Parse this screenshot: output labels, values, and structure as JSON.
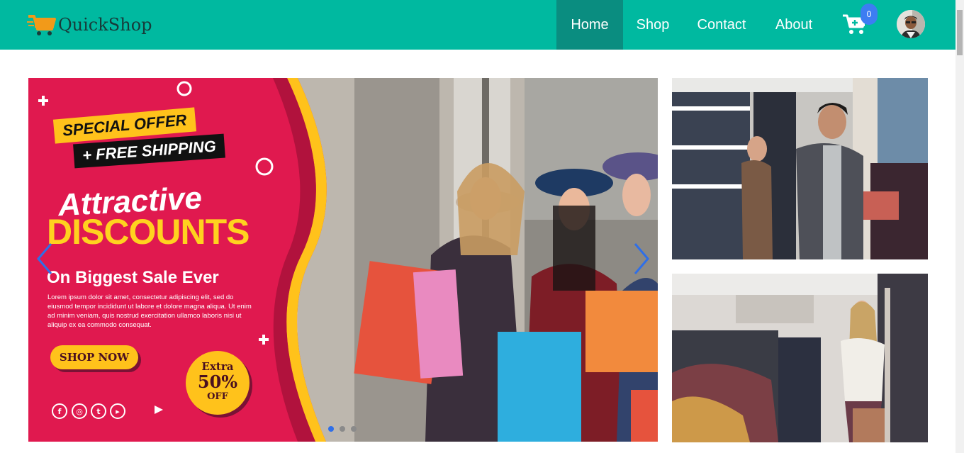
{
  "brand": {
    "name": "QuickShop"
  },
  "nav": {
    "items": [
      {
        "label": "Home",
        "active": true
      },
      {
        "label": "Shop",
        "active": false
      },
      {
        "label": "Contact",
        "active": false
      },
      {
        "label": "About",
        "active": false
      }
    ],
    "cart_count": "0",
    "cart_icon": "shopping-cart-icon",
    "avatar_icon": "user-avatar"
  },
  "hero": {
    "tag_1": "SPECIAL OFFER",
    "tag_2": "+ FREE SHIPPING",
    "headline_1": "Attractive",
    "headline_2": "DISCOUNTS",
    "subheadline": "On Biggest Sale Ever",
    "body": "Lorem ipsum dolor sit amet, consectetur adipiscing elit, sed do eiusmod tempor incididunt ut labore et dolore magna aliqua. Ut enim ad minim veniam, quis nostrud exercitation ullamco laboris nisi ut aliquip ex ea commodo consequat.",
    "cta": "SHOP NOW",
    "badge_line_1": "Extra",
    "badge_line_2": "50%",
    "badge_line_3": "OFF",
    "social_icons": [
      "facebook-icon",
      "instagram-icon",
      "twitter-icon",
      "youtube-icon",
      "play-icon"
    ],
    "slide_count": 3,
    "active_slide": 1
  },
  "colors": {
    "navbar": "#00b9a0",
    "nav_active": "#0a8d80",
    "promo_background": "#e0194f",
    "promo_accent": "#ffc21b",
    "badge": "#3d7df2",
    "carousel_arrow": "#2f6fe8"
  }
}
